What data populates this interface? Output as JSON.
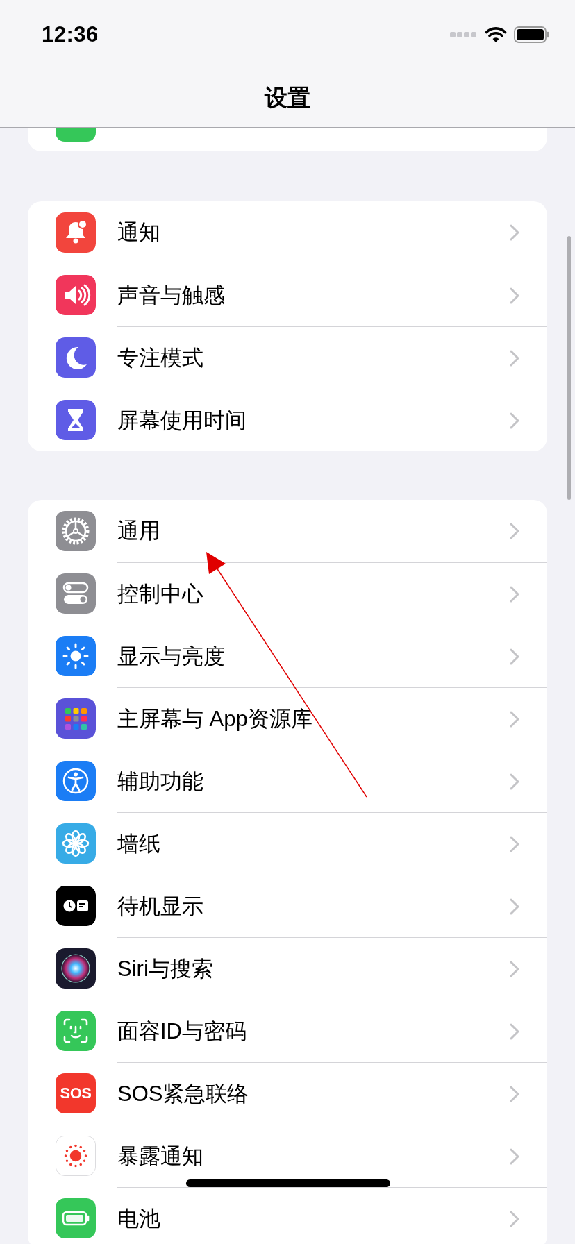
{
  "status_bar": {
    "time": "12:36"
  },
  "nav": {
    "title": "设置"
  },
  "partial_group": {
    "kind": "cellular"
  },
  "groups": [
    {
      "rows": [
        {
          "kind": "notifications",
          "label": "通知"
        },
        {
          "kind": "sounds",
          "label": "声音与触感"
        },
        {
          "kind": "focus",
          "label": "专注模式"
        },
        {
          "kind": "screen_time",
          "label": "屏幕使用时间"
        }
      ]
    },
    {
      "rows": [
        {
          "kind": "general",
          "label": "通用"
        },
        {
          "kind": "control_center",
          "label": "控制中心"
        },
        {
          "kind": "display",
          "label": "显示与亮度"
        },
        {
          "kind": "home_screen",
          "label": "主屏幕与 App资源库"
        },
        {
          "kind": "accessibility",
          "label": "辅助功能"
        },
        {
          "kind": "wallpaper",
          "label": "墙纸"
        },
        {
          "kind": "standby",
          "label": "待机显示"
        },
        {
          "kind": "siri",
          "label": "Siri与搜索"
        },
        {
          "kind": "face_id",
          "label": "面容ID与密码"
        },
        {
          "kind": "sos",
          "label": "SOS紧急联络",
          "icon_text": "SOS"
        },
        {
          "kind": "exposure",
          "label": "暴露通知"
        },
        {
          "kind": "battery",
          "label": "电池"
        }
      ]
    }
  ]
}
